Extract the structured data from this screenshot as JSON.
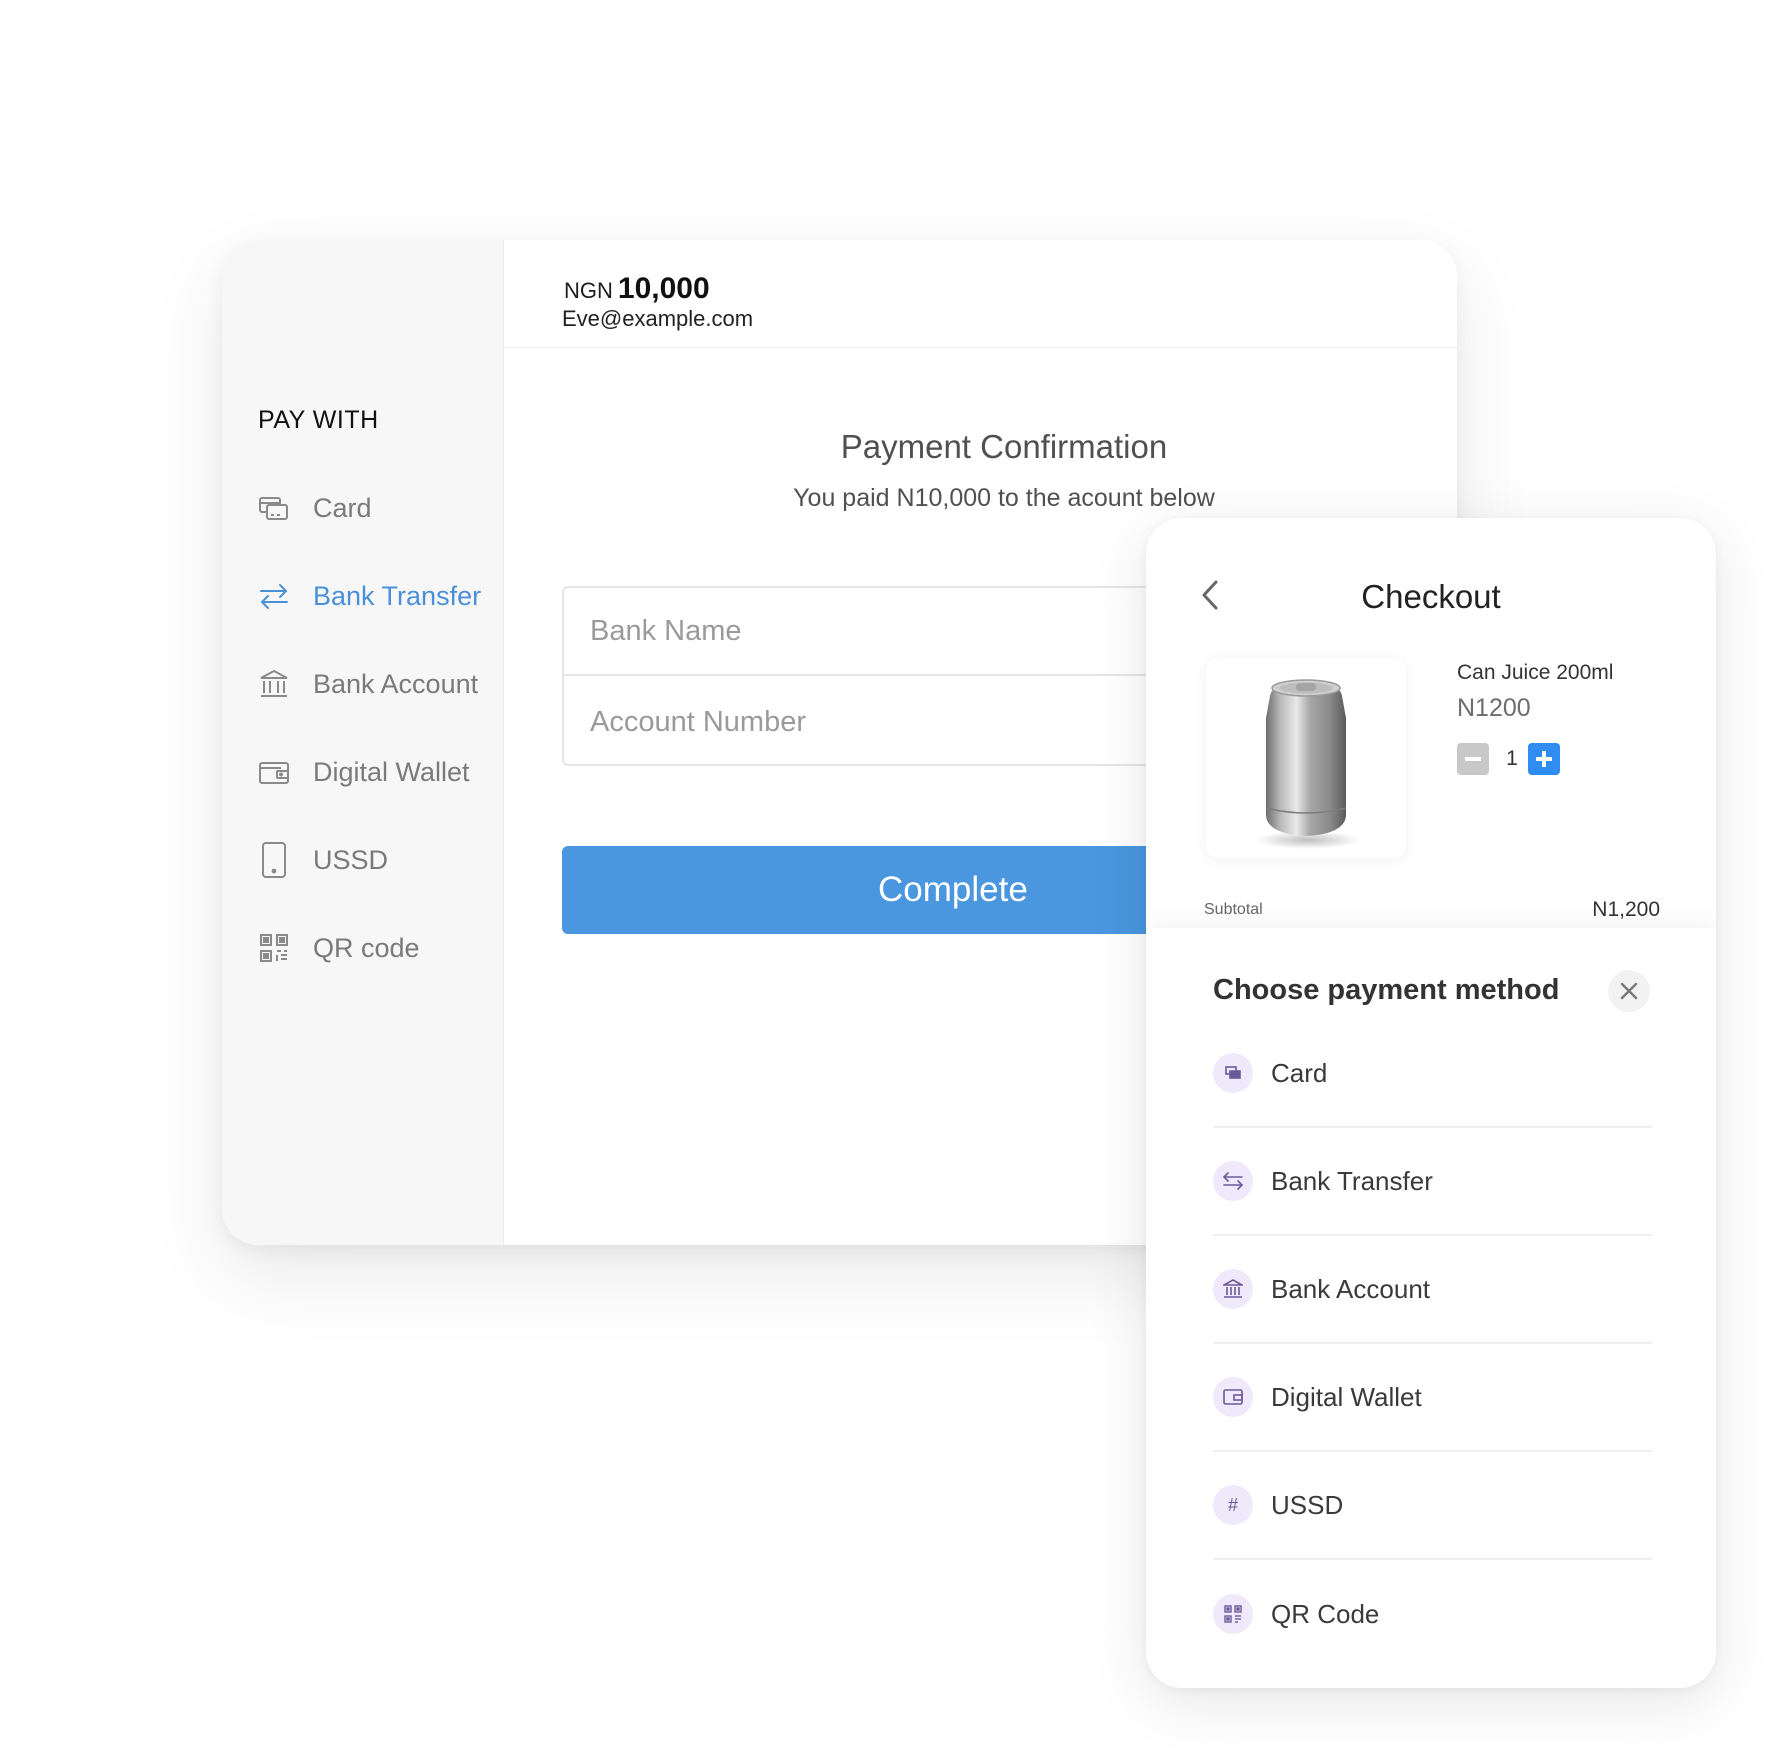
{
  "payment_panel": {
    "currency": "NGN",
    "amount": "10,000",
    "email": "Eve@example.com",
    "sidebar_heading": "PAY WITH",
    "methods": [
      {
        "label": "Card",
        "icon": "card-icon"
      },
      {
        "label": "Bank Transfer",
        "icon": "transfer-icon",
        "active": true
      },
      {
        "label": "Bank Account",
        "icon": "bank-icon"
      },
      {
        "label": "Digital Wallet",
        "icon": "wallet-icon"
      },
      {
        "label": "USSD",
        "icon": "phone-icon"
      },
      {
        "label": "QR code",
        "icon": "qr-icon"
      }
    ],
    "title": "Payment Confirmation",
    "subtitle": "You paid N10,000 to the acount below",
    "bank_name_placeholder": "Bank Name",
    "account_number_placeholder": "Account Number",
    "complete_label": "Complete",
    "active_color": "#4a90d9",
    "button_color": "#4a97e0"
  },
  "checkout": {
    "title": "Checkout",
    "product": {
      "name": "Can Juice 200ml",
      "price": "N1200",
      "quantity": "1"
    },
    "subtotal_label": "Subtotal",
    "subtotal_value": "N1,200",
    "sheet_title": "Choose payment method",
    "methods": [
      {
        "label": "Card",
        "icon": "card-icon"
      },
      {
        "label": "Bank Transfer",
        "icon": "transfer-icon"
      },
      {
        "label": "Bank Account",
        "icon": "bank-icon"
      },
      {
        "label": "Digital Wallet",
        "icon": "wallet-icon"
      },
      {
        "label": "USSD",
        "icon": "hash-icon",
        "glyph": "#"
      },
      {
        "label": "QR Code",
        "icon": "qr-icon"
      }
    ],
    "icon_bg_color": "#efe9fb",
    "plus_color": "#2f8cf0"
  }
}
